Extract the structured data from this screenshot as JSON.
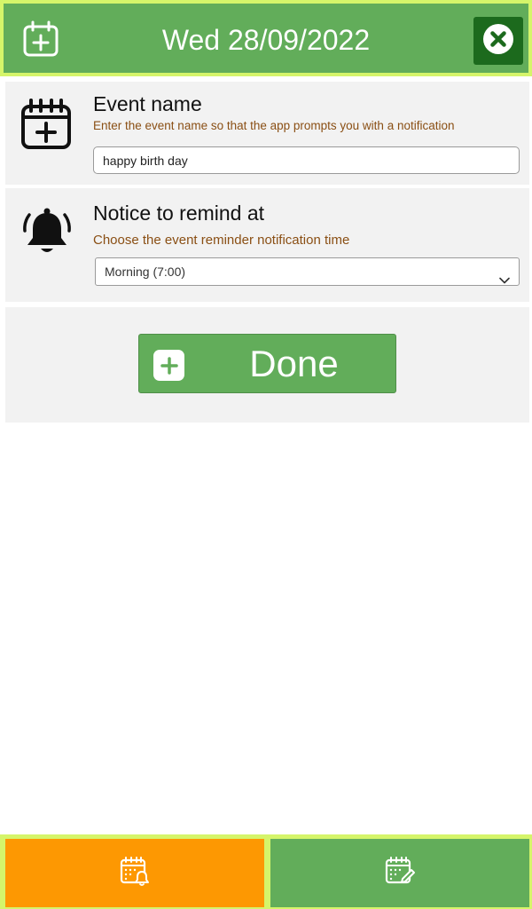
{
  "header": {
    "date_title": "Wed 28/09/2022",
    "icon": "calendar-plus-icon",
    "close_icon": "close-icon"
  },
  "event_section": {
    "icon": "calendar-plus-icon",
    "title": "Event name",
    "hint": "Enter the event name so that the app prompts you with a notification",
    "input_value": "happy birth day"
  },
  "remind_section": {
    "icon": "bell-icon",
    "title": "Notice to remind at",
    "hint": "Choose the event reminder notification time",
    "selected_option": "Morning (7:00)"
  },
  "done_button": {
    "label": "Done",
    "icon": "plus-icon"
  },
  "bottom_nav": {
    "left_icon": "calendar-bell-icon",
    "right_icon": "calendar-edit-icon"
  },
  "colors": {
    "primary_green": "#62ad5a",
    "header_border": "#d5f56a",
    "close_button": "#1c6a1d",
    "orange": "#fd9802",
    "hint_brown": "#8a4f14"
  }
}
